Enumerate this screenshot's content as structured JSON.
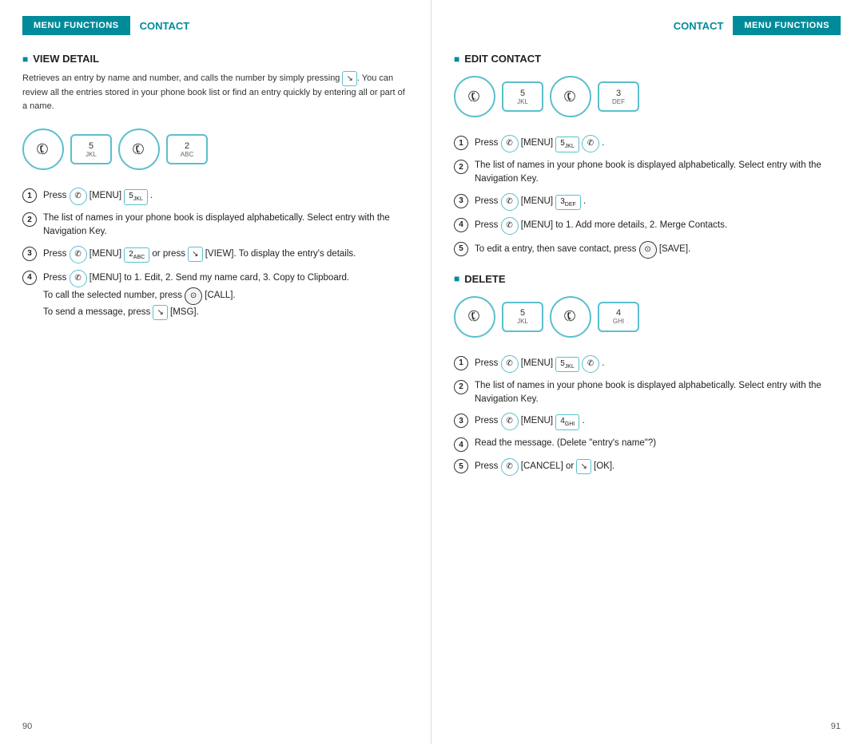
{
  "left": {
    "header": {
      "menu_functions": "MENU FUNCTIONS",
      "contact": "CONTACT"
    },
    "view_detail": {
      "title": "VIEW DETAIL",
      "description": "Retrieves an entry by name and number, and calls the number by simply pressing ↘. You can review all the entries stored in your phone book list or find an entry quickly by entering all or part of a name.",
      "steps": [
        {
          "num": "1",
          "text": "Press ☏ [MENU] ⬜5jkl ."
        },
        {
          "num": "2",
          "text": "The list of names in your phone book is displayed alphabetically. Select entry with the Navigation Key."
        },
        {
          "num": "3",
          "text": "Press ☏ [MENU] ⬜2abc or press ↘ [VIEW]. To display the entry's details."
        },
        {
          "num": "4",
          "text": "Press ☏ [MENU] to 1. Edit, 2. Send my name card, 3. Copy to Clipboard. To call the selected number, press ⊙ [CALL]. To send a message, press ↘ [MSG]."
        }
      ]
    },
    "page_num": "90"
  },
  "right": {
    "header": {
      "contact": "CONTACT",
      "menu_functions": "MENU FUNCTIONS"
    },
    "edit_contact": {
      "title": "EDIT CONTACT",
      "steps": [
        {
          "num": "1",
          "text": "Press ☏ [MENU] ⬜5jkl ☏ ."
        },
        {
          "num": "2",
          "text": "The list of names in your phone book is displayed alphabetically. Select entry with the Navigation Key."
        },
        {
          "num": "3",
          "text": "Press ☏ [MENU] ⬜3def ."
        },
        {
          "num": "4",
          "text": "Press ☏ [MENU] to 1. Add more details, 2. Merge Contacts."
        },
        {
          "num": "5",
          "text": "To edit a entry, then save contact, press ⊙ [SAVE]."
        }
      ]
    },
    "delete": {
      "title": "DELETE",
      "steps": [
        {
          "num": "1",
          "text": "Press ☏ [MENU] ⬜5jkl ☏ ."
        },
        {
          "num": "2",
          "text": "The list of names in your phone book is displayed alphabetically. Select entry with the Navigation Key."
        },
        {
          "num": "3",
          "text": "Press ☏ [MENU] ⬜4ghi ."
        },
        {
          "num": "4",
          "text": "Read the message. (Delete \"entry's name\"?)"
        },
        {
          "num": "5",
          "text": "Press ☏ [CANCEL] or ↘ [OK]."
        }
      ]
    },
    "page_num": "91"
  },
  "keys": {
    "phone_char": "☏",
    "nav_char": "⊙",
    "arrow_char": "↘"
  }
}
